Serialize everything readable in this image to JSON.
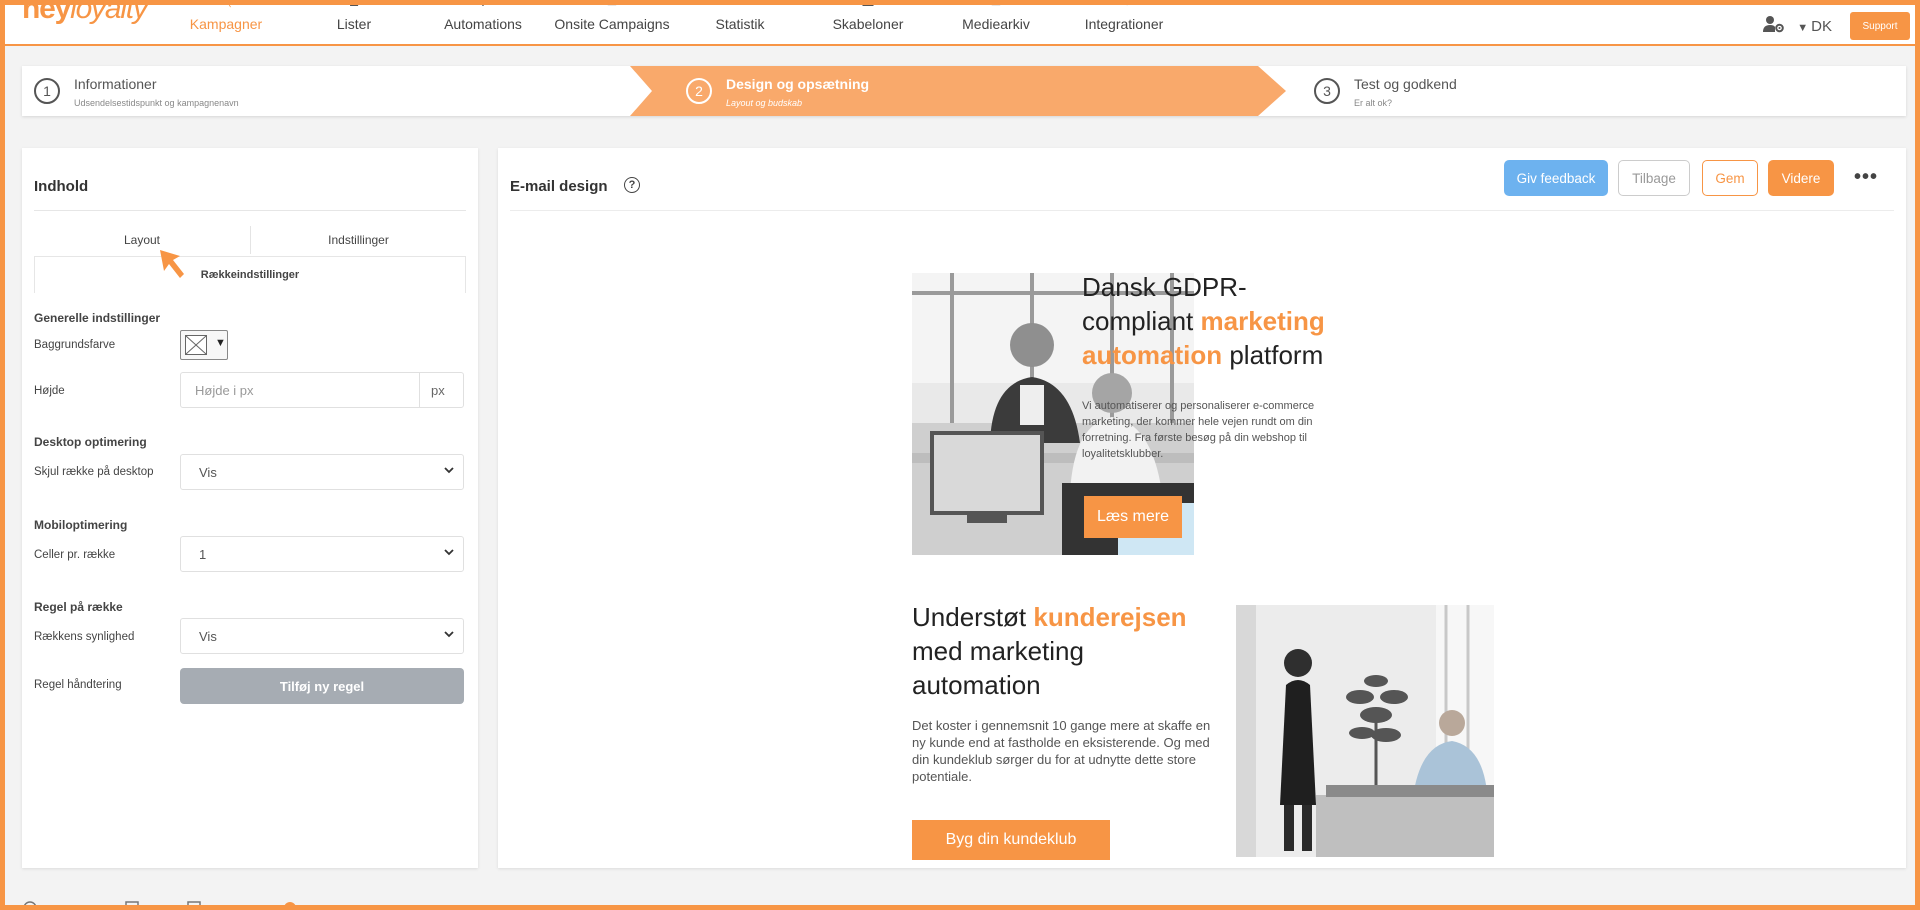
{
  "brand": {
    "logo_hey": "hey",
    "logo_loyalty": "loyalty",
    "accent": "#f79545"
  },
  "nav": {
    "items": [
      {
        "label": "Kampagner",
        "icon": "megaphone-icon",
        "active": true
      },
      {
        "label": "Lister",
        "icon": "list-icon"
      },
      {
        "label": "Automations",
        "icon": "gear-icon"
      },
      {
        "label": "Onsite Campaigns",
        "icon": "window-icon"
      },
      {
        "label": "Statistik",
        "icon": "bar-chart-icon"
      },
      {
        "label": "Skabeloner",
        "icon": "template-icon"
      },
      {
        "label": "Mediearkiv",
        "icon": "media-icon"
      },
      {
        "label": "Integrationer",
        "icon": "plug-icon"
      }
    ],
    "language": "DK",
    "support_label": "Support"
  },
  "stepper": [
    {
      "num": "1",
      "title": "Informationer",
      "subtitle": "Udsendelsestidspunkt og kampagnenavn"
    },
    {
      "num": "2",
      "title": "Design og opsætning",
      "subtitle": "Layout og budskab",
      "active": true
    },
    {
      "num": "3",
      "title": "Test og godkend",
      "subtitle": "Er alt ok?"
    }
  ],
  "left": {
    "title": "Indhold",
    "tabs": [
      "Layout",
      "Indstillinger"
    ],
    "subtab": "Rækkeindstillinger",
    "general": {
      "title": "Generelle indstillinger",
      "bg_label": "Baggrundsfarve",
      "height_label": "Højde",
      "height_placeholder": "Højde i px",
      "height_unit": "px"
    },
    "desktop": {
      "title": "Desktop optimering",
      "label": "Skjul række på desktop",
      "value": "Vis"
    },
    "mobile": {
      "title": "Mobiloptimering",
      "label": "Celler pr. række",
      "value": "1"
    },
    "rule": {
      "title": "Regel på række",
      "visibility_label": "Rækkens synlighed",
      "visibility_value": "Vis",
      "handling_label": "Regel håndtering",
      "button": "Tilføj ny regel"
    }
  },
  "right": {
    "title": "E-mail design",
    "buttons": {
      "feedback": "Giv feedback",
      "back": "Tilbage",
      "save": "Gem",
      "next": "Videre"
    }
  },
  "email": {
    "block1": {
      "line1": "Dansk GDPR-",
      "line2_pre": "compliant ",
      "line2_hl": "marketing",
      "line3_hl": "automation",
      "line3_post": " platform",
      "body": "Vi automatiserer og personaliserer e-commerce marketing, der kommer hele vejen rundt om din forretning. Fra første besøg på din webshop til loyalitetsklubber.",
      "cta": "Læs mere"
    },
    "block2": {
      "line1_pre": "Understøt ",
      "line1_hl": "kunderejsen",
      "line2": "med marketing",
      "line3": "automation",
      "body": "Det koster i gennemsnit 10 gange mere at skaffe en ny kunde end at fastholde en eksisterende. Og med din kundeklub sørger du for at udnytte dette store potentiale.",
      "cta": "Byg din kundeklub"
    }
  }
}
